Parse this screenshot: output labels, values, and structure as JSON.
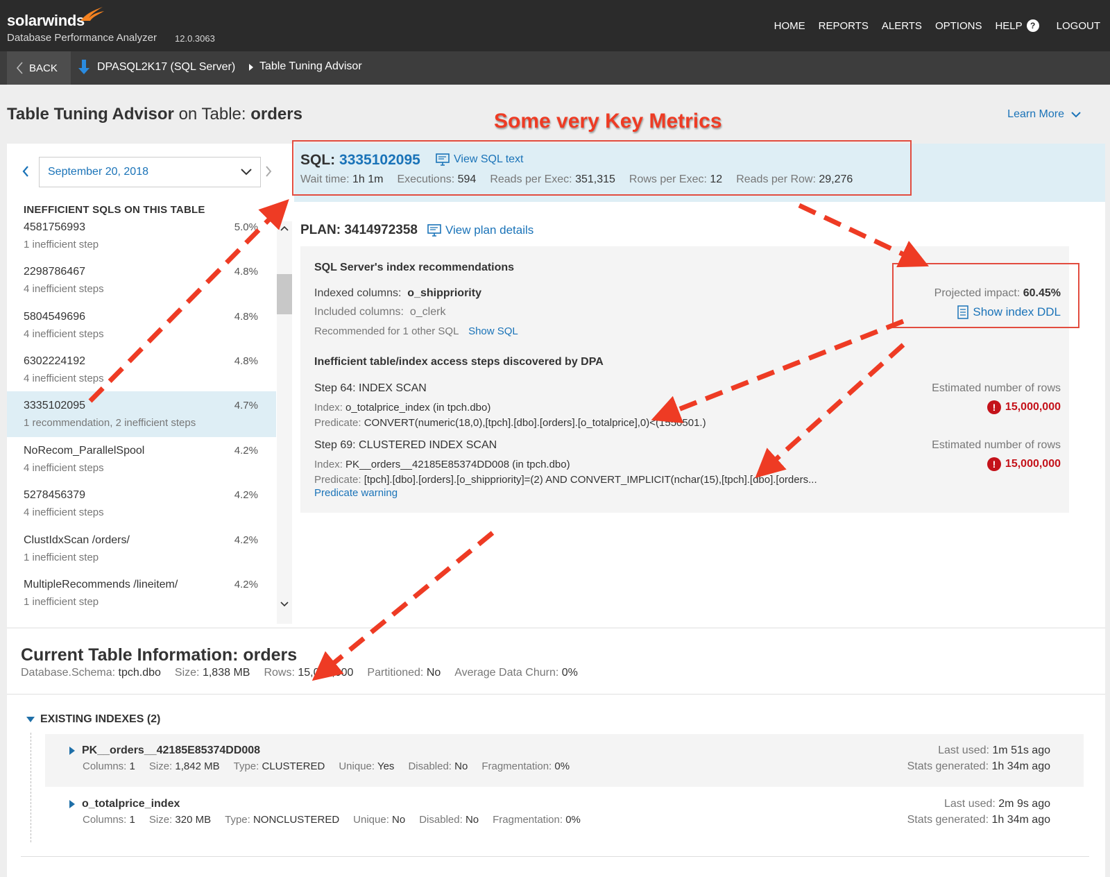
{
  "app": {
    "brand": "solarwinds",
    "product": "Database Performance Analyzer",
    "version": "12.0.3063"
  },
  "nav": {
    "items": [
      "HOME",
      "REPORTS",
      "ALERTS",
      "OPTIONS",
      "HELP",
      "LOGOUT"
    ]
  },
  "breadcrumb": {
    "back": "BACK",
    "database": "DPASQL2K17 (SQL Server)",
    "page": "Table Tuning Advisor"
  },
  "page": {
    "title_main": "Table Tuning Advisor",
    "title_mid": "on Table:",
    "title_table": "orders",
    "learn_more": "Learn More",
    "annotation": "Some very Key Metrics"
  },
  "date_picker": {
    "value": "September 20, 2018"
  },
  "sql_list": {
    "heading": "INEFFICIENT SQLS ON THIS TABLE",
    "items": [
      {
        "name": "4581756993",
        "sub": "1 inefficient step",
        "pct": "5.0%"
      },
      {
        "name": "2298786467",
        "sub": "4 inefficient steps",
        "pct": "4.8%"
      },
      {
        "name": "5804549696",
        "sub": "4 inefficient steps",
        "pct": "4.8%"
      },
      {
        "name": "6302224192",
        "sub": "4 inefficient steps",
        "pct": "4.8%"
      },
      {
        "name": "3335102095",
        "sub": "1 recommendation, 2 inefficient steps",
        "pct": "4.7%"
      },
      {
        "name": "NoRecom_ParallelSpool",
        "sub": "4 inefficient steps",
        "pct": "4.2%"
      },
      {
        "name": "5278456379",
        "sub": "4 inefficient steps",
        "pct": "4.2%"
      },
      {
        "name": "ClustIdxScan /orders/",
        "sub": "1 inefficient step",
        "pct": "4.2%"
      },
      {
        "name": "MultipleRecommends /lineitem/",
        "sub": "1 inefficient step",
        "pct": "4.2%"
      }
    ]
  },
  "sql_detail": {
    "label": "SQL:",
    "id": "3335102095",
    "view_text": "View SQL text",
    "metrics": [
      {
        "k": "Wait time:",
        "v": "1h 1m"
      },
      {
        "k": "Executions:",
        "v": "594"
      },
      {
        "k": "Reads per Exec:",
        "v": "351,315"
      },
      {
        "k": "Rows per Exec:",
        "v": "12"
      },
      {
        "k": "Reads per Row:",
        "v": "29,276"
      }
    ]
  },
  "plan": {
    "label": "PLAN: 3414972358",
    "view_details": "View plan details"
  },
  "recommendation": {
    "title": "SQL Server's index recommendations",
    "indexed_k": "Indexed columns:",
    "indexed_v": "o_shippriority",
    "included_k": "Included columns:",
    "included_v": "o_clerk",
    "other": "Recommended for 1 other SQL",
    "show_sql": "Show SQL",
    "impact_k": "Projected impact:",
    "impact_v": "60.45%",
    "show_ddl": "Show index DDL"
  },
  "steps": {
    "title": "Inefficient table/index access steps discovered by DPA",
    "est_label": "Estimated number of rows",
    "items": [
      {
        "name": "Step 64: INDEX SCAN",
        "index_k": "Index:",
        "index_v": "o_totalprice_index (in tpch.dbo)",
        "pred_k": "Predicate:",
        "pred_v": "CONVERT(numeric(18,0),[tpch].[dbo].[orders].[o_totalprice],0)<(1550501.)",
        "rows": "15,000,000"
      },
      {
        "name": "Step 69: CLUSTERED INDEX SCAN",
        "index_k": "Index:",
        "index_v": "PK__orders__42185E85374DD008 (in tpch.dbo)",
        "pred_k": "Predicate:",
        "pred_v": "[tpch].[dbo].[orders].[o_shippriority]=(2) AND CONVERT_IMPLICIT(nchar(15),[tpch].[dbo].[orders...",
        "rows": "15,000,000"
      }
    ],
    "predicate_warning": "Predicate warning"
  },
  "table_info": {
    "title": "Current Table Information: orders",
    "meta": [
      {
        "k": "Database.Schema:",
        "v": "tpch.dbo"
      },
      {
        "k": "Size:",
        "v": "1,838 MB"
      },
      {
        "k": "Rows:",
        "v": "15,000,000"
      },
      {
        "k": "Partitioned:",
        "v": "No"
      },
      {
        "k": "Average Data Churn:",
        "v": "0%"
      }
    ],
    "existing_heading": "EXISTING INDEXES (2)",
    "indexes": [
      {
        "name": "PK__orders__42185E85374DD008",
        "meta": [
          {
            "k": "Columns:",
            "v": "1"
          },
          {
            "k": "Size:",
            "v": "1,842 MB"
          },
          {
            "k": "Type:",
            "v": "CLUSTERED"
          },
          {
            "k": "Unique:",
            "v": "Yes"
          },
          {
            "k": "Disabled:",
            "v": "No"
          },
          {
            "k": "Fragmentation:",
            "v": "0%"
          }
        ],
        "last_used_k": "Last used:",
        "last_used_v": "1m 51s ago",
        "stats_k": "Stats generated:",
        "stats_v": "1h 34m ago"
      },
      {
        "name": "o_totalprice_index",
        "meta": [
          {
            "k": "Columns:",
            "v": "1"
          },
          {
            "k": "Size:",
            "v": "320 MB"
          },
          {
            "k": "Type:",
            "v": "NONCLUSTERED"
          },
          {
            "k": "Unique:",
            "v": "No"
          },
          {
            "k": "Disabled:",
            "v": "No"
          },
          {
            "k": "Fragmentation:",
            "v": "0%"
          }
        ],
        "last_used_k": "Last used:",
        "last_used_v": "2m 9s ago",
        "stats_k": "Stats generated:",
        "stats_v": "1h 34m ago"
      }
    ]
  },
  "colors": {
    "accent": "#1a73b8",
    "annotation": "#ee3b24",
    "danger": "#c4121a",
    "topbar": "#2b2b2b",
    "selected": "#deeef5"
  }
}
